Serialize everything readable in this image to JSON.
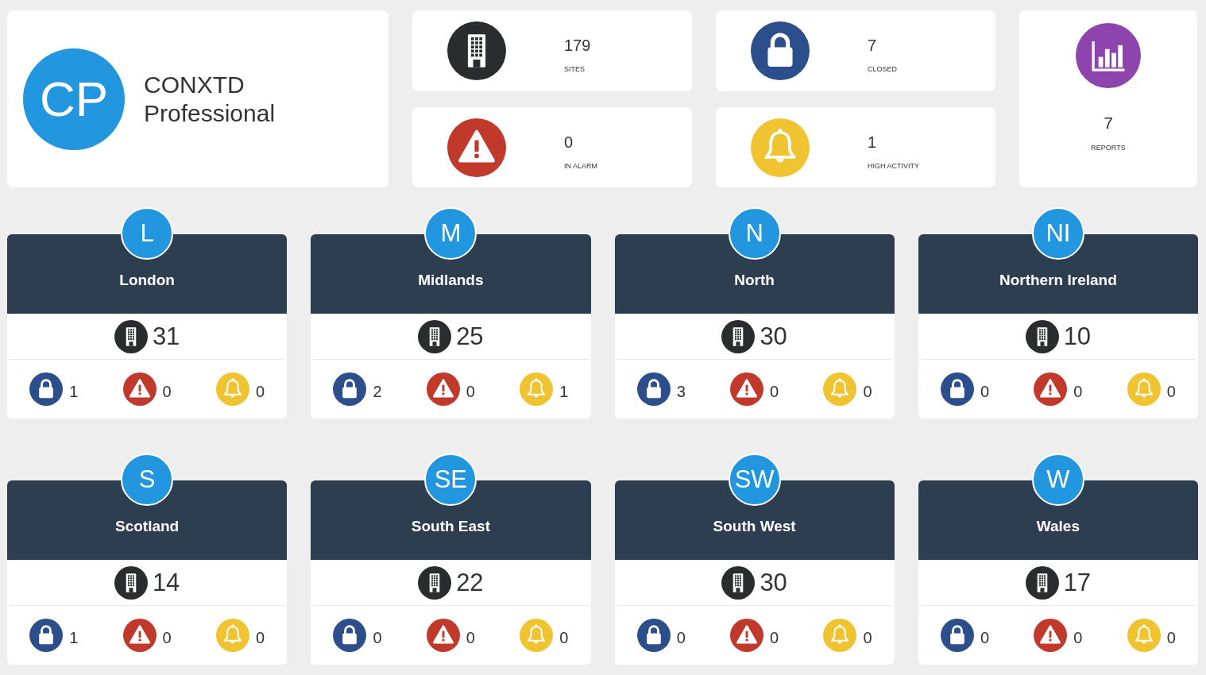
{
  "brand": {
    "initials": "CP",
    "title": "CONXTD",
    "subtitle": "Professional"
  },
  "stats": [
    {
      "kind": "sites",
      "value": "179",
      "label": "SITES"
    },
    {
      "kind": "closed",
      "value": "7",
      "label": "CLOSED"
    },
    {
      "kind": "alarm",
      "value": "0",
      "label": "IN ALARM"
    },
    {
      "kind": "activity",
      "value": "1",
      "label": "HIGH ACTIVITY"
    }
  ],
  "reports": {
    "kind": "reports",
    "value": "7",
    "label": "REPORTS"
  },
  "regions": [
    {
      "initials": "L",
      "name": "London",
      "sites": "31",
      "counts": [
        {
          "kind": "closed",
          "value": "1"
        },
        {
          "kind": "alarm",
          "value": "0"
        },
        {
          "kind": "activity",
          "value": "0"
        }
      ]
    },
    {
      "initials": "M",
      "name": "Midlands",
      "sites": "25",
      "counts": [
        {
          "kind": "closed",
          "value": "2"
        },
        {
          "kind": "alarm",
          "value": "0"
        },
        {
          "kind": "activity",
          "value": "1"
        }
      ]
    },
    {
      "initials": "N",
      "name": "North",
      "sites": "30",
      "counts": [
        {
          "kind": "closed",
          "value": "3"
        },
        {
          "kind": "alarm",
          "value": "0"
        },
        {
          "kind": "activity",
          "value": "0"
        }
      ]
    },
    {
      "initials": "NI",
      "name": "Northern Ireland",
      "sites": "10",
      "counts": [
        {
          "kind": "closed",
          "value": "0"
        },
        {
          "kind": "alarm",
          "value": "0"
        },
        {
          "kind": "activity",
          "value": "0"
        }
      ]
    },
    {
      "initials": "S",
      "name": "Scotland",
      "sites": "14",
      "counts": [
        {
          "kind": "closed",
          "value": "1"
        },
        {
          "kind": "alarm",
          "value": "0"
        },
        {
          "kind": "activity",
          "value": "0"
        }
      ]
    },
    {
      "initials": "SE",
      "name": "South East",
      "sites": "22",
      "counts": [
        {
          "kind": "closed",
          "value": "0"
        },
        {
          "kind": "alarm",
          "value": "0"
        },
        {
          "kind": "activity",
          "value": "0"
        }
      ]
    },
    {
      "initials": "SW",
      "name": "South West",
      "sites": "30",
      "counts": [
        {
          "kind": "closed",
          "value": "0"
        },
        {
          "kind": "alarm",
          "value": "0"
        },
        {
          "kind": "activity",
          "value": "0"
        }
      ]
    },
    {
      "initials": "W",
      "name": "Wales",
      "sites": "17",
      "counts": [
        {
          "kind": "closed",
          "value": "0"
        },
        {
          "kind": "alarm",
          "value": "0"
        },
        {
          "kind": "activity",
          "value": "0"
        }
      ]
    }
  ]
}
